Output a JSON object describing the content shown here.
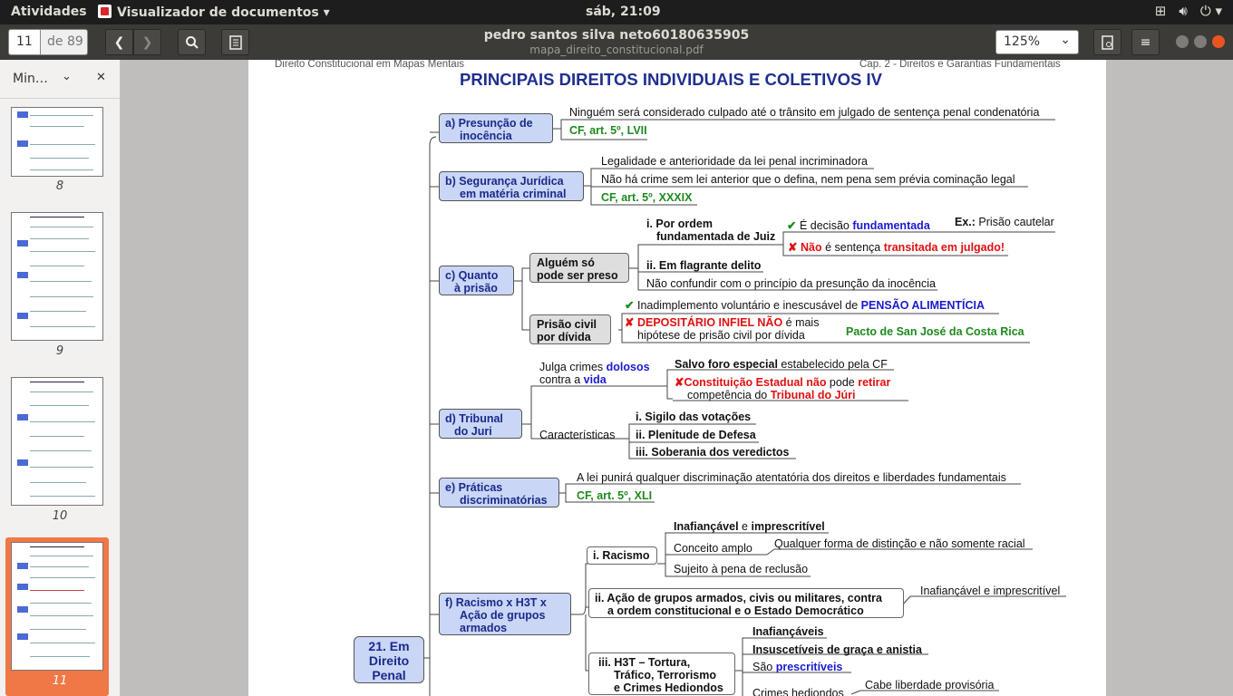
{
  "topbar": {
    "activities": "Atividades",
    "app_name": "Visualizador de documentos",
    "clock": "sáb, 21:09"
  },
  "header": {
    "page_current": "11",
    "page_of": "de 89",
    "doc_title": "pedro santos silva neto60180635905",
    "doc_file": "mapa_direito_constitucional.pdf",
    "zoom": "125%"
  },
  "sidebar": {
    "mode_label": "Min…",
    "thumbnails": [
      {
        "page": "8"
      },
      {
        "page": "9"
      },
      {
        "page": "10"
      },
      {
        "page": "11"
      }
    ]
  },
  "document": {
    "header_left": "Direito Constitucional em Mapas Mentais",
    "header_right": "Cap. 2 - Direitos e Garantias Fundamentais",
    "title": "PRINCIPAIS DIREITOS INDIVIDUAIS E COLETIVOS IV",
    "root": [
      "21. Em",
      "Direito",
      "Penal"
    ],
    "a": {
      "node": [
        "a) Presunção de",
        "inocência"
      ],
      "text": "Ninguém será considerado culpado até o trânsito em julgado de sentença penal condenatória",
      "ref": "CF, art. 5º, LVII"
    },
    "b": {
      "node": [
        "b) Segurança Jurídica",
        "em matéria criminal"
      ],
      "t1": "Legalidade e anterioridade da lei penal incriminadora",
      "t2": "Não há crime sem lei anterior que o defina, nem pena sem prévia cominação legal",
      "ref": "CF, art. 5º, XXXIX"
    },
    "c": {
      "node": [
        "c) Quanto",
        "à prisão"
      ],
      "g1": [
        "Alguém só",
        "pode ser preso"
      ],
      "i1": [
        "i. Por ordem",
        "fundamentada de Juiz"
      ],
      "ok1a": "É decisão ",
      "ok1b": "fundamentada",
      "ex_label": "Ex.:",
      "ex_text": " Prisão cautelar",
      "no1a": "Não",
      "no1b": " é sentença ",
      "no1c": "transitada em julgado!",
      "i2": "ii. Em flagrante delito",
      "note": "Não confundir com o princípio da presunção da inocência",
      "g2": [
        "Prisão civil",
        "por dívida"
      ],
      "ok2a": "Inadimplemento voluntário e inescusável de ",
      "ok2b": "PENSÃO ALIMENTÍCIA",
      "no2a": "DEPOSITÁRIO INFIEL NÃO",
      "no2b": " é mais",
      "no2c": "hipótese de prisão civil por dívida",
      "pacto": "Pacto de San José da Costa Rica"
    },
    "d": {
      "node": [
        "d) Tribunal",
        "do Juri"
      ],
      "j1": "Julga crimes ",
      "j2": "dolosos",
      "j3": "contra a ",
      "j4": "vida",
      "s1": "Salvo foro especial",
      "s2": " estabelecido pela CF",
      "ce1": "Constituição Estadual não",
      "ce2": " pode ",
      "ce3": "retirar",
      "ce4": "competência do ",
      "ce5": "Tribunal do Júri",
      "carac": "Características",
      "c1": "i. Sigilo das votações",
      "c2": "ii. Plenitude de Defesa",
      "c3": "iii. Soberania dos veredictos"
    },
    "e": {
      "node": [
        "e) Práticas",
        "discriminatórias"
      ],
      "text": "A lei punirá qualquer discriminação atentatória dos direitos e liberdades fundamentais",
      "ref": "CF, art. 5º, XLI"
    },
    "f": {
      "node": [
        "f) Racismo x H3T x",
        "Ação de grupos",
        "armados"
      ],
      "r": "i. Racismo",
      "r1a": "Inafiançável",
      "r1b": " e ",
      "r1c": "imprescritível",
      "r2": "Conceito amplo",
      "r2b": "Qualquer forma de distinção e não somente racial",
      "r3": "Sujeito à pena de reclusão",
      "ii": [
        "ii. Ação de grupos armados, civis ou militares, contra",
        "a ordem constitucional e o Estado Democrático"
      ],
      "ii_t": "Inafiançável e imprescritível",
      "iii": [
        "iii. H3T – Tortura,",
        "Tráfico, Terrorismo",
        "e Crimes Hediondos"
      ],
      "h1": "Inafiançáveis",
      "h2": "Insuscetíveis de graça e anistia",
      "h3a": "São ",
      "h3b": "prescritíveis",
      "h4": "Crimes hediondos",
      "h4b": "Cabe liberdade provisória"
    }
  }
}
